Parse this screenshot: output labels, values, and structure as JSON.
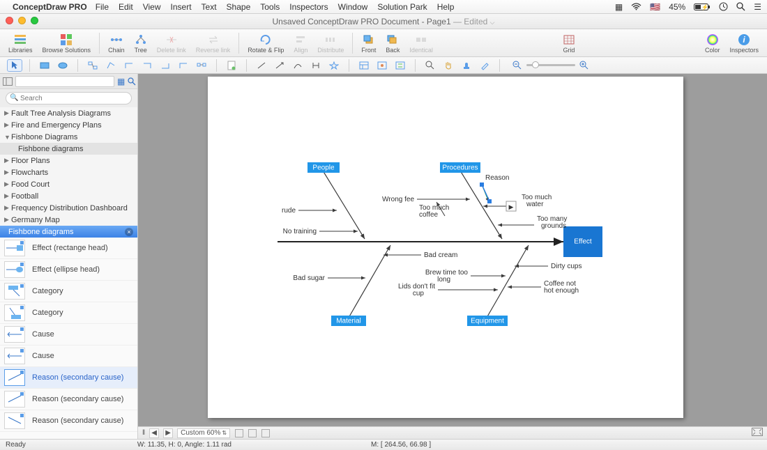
{
  "menu": {
    "app": "ConceptDraw PRO",
    "items": [
      "File",
      "Edit",
      "View",
      "Insert",
      "Text",
      "Shape",
      "Tools",
      "Inspectors",
      "Window",
      "Solution Park",
      "Help"
    ],
    "battery": "45%"
  },
  "title": {
    "text": "Unsaved ConceptDraw PRO Document - Page1",
    "suffix": " — Edited"
  },
  "toolbar": {
    "libraries": "Libraries",
    "browse": "Browse Solutions",
    "chain": "Chain",
    "tree": "Tree",
    "delete_link": "Delete link",
    "reverse_link": "Reverse link",
    "rotate_flip": "Rotate & Flip",
    "align": "Align",
    "distribute": "Distribute",
    "front": "Front",
    "back": "Back",
    "identical": "Identical",
    "grid": "Grid",
    "color": "Color",
    "inspectors": "Inspectors"
  },
  "left": {
    "search_placeholder": "Search",
    "tree": [
      {
        "label": "Fault Tree Analysis Diagrams",
        "open": false
      },
      {
        "label": "Fire and Emergency Plans",
        "open": false
      },
      {
        "label": "Fishbone Diagrams",
        "open": true,
        "children": [
          {
            "label": "Fishbone diagrams"
          }
        ]
      },
      {
        "label": "Floor Plans",
        "open": false
      },
      {
        "label": "Flowcharts",
        "open": false
      },
      {
        "label": "Food Court",
        "open": false
      },
      {
        "label": "Football",
        "open": false
      },
      {
        "label": "Frequency Distribution Dashboard",
        "open": false
      },
      {
        "label": "Germany Map",
        "open": false
      }
    ],
    "active_lib": "Fishbone diagrams",
    "shapes": [
      "Effect (rectange head)",
      "Effect (ellipse head)",
      "Category",
      "Category",
      "Cause",
      "Cause",
      "Reason (secondary cause)",
      "Reason (secondary cause)",
      "Reason (secondary cause)"
    ],
    "selected_shape_index": 6
  },
  "diagram": {
    "effect": "Effect",
    "categories": {
      "people": "People",
      "procedures": "Procedures",
      "material": "Material",
      "equipment": "Equipment"
    },
    "causes": {
      "rude": "rude",
      "no_training": "No training",
      "wrong_fee": "Wrong fee",
      "too_much_coffee_l1": "Too much",
      "too_much_coffee_l2": "coffee",
      "reason": "Reason",
      "too_much_water_l1": "Too much",
      "too_much_water_l2": "water",
      "too_many_grounds_l1": "Too many",
      "too_many_grounds_l2": "grounds",
      "bad_sugar": "Bad sugar",
      "bad_cream": "Bad cream",
      "brew_time_l1": "Brew time too",
      "brew_time_l2": "long",
      "lids_l1": "Lids don't fit",
      "lids_l2": "cup",
      "dirty_cups": "Dirty cups",
      "coffee_not_hot_l1": "Coffee not",
      "coffee_not_hot_l2": "hot enough"
    }
  },
  "hscroll": {
    "zoom_label": "Custom 60%"
  },
  "status": {
    "ready": "Ready",
    "dims": "W: 11.35,  H: 0,  Angle: 1.11 rad",
    "coords": "M: [ 264.56, 66.98 ]"
  }
}
